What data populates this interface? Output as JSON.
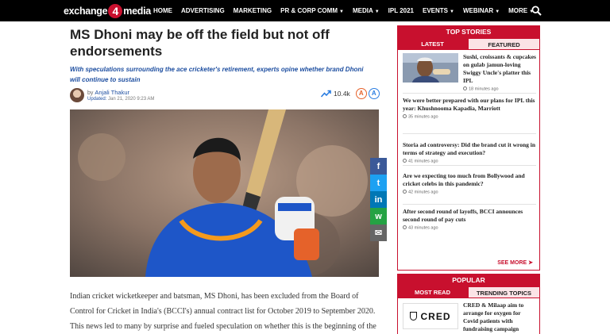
{
  "nav": {
    "logo_prefix": "exchange",
    "logo_number": "4",
    "logo_suffix": "media",
    "items": [
      {
        "label": "HOME",
        "dropdown": false
      },
      {
        "label": "ADVERTISING",
        "dropdown": false
      },
      {
        "label": "MARKETING",
        "dropdown": false
      },
      {
        "label": "PR & CORP COMM",
        "dropdown": true
      },
      {
        "label": "MEDIA",
        "dropdown": true
      },
      {
        "label": "IPL 2021",
        "dropdown": false
      },
      {
        "label": "EVENTS",
        "dropdown": true
      },
      {
        "label": "WEBINAR",
        "dropdown": true
      },
      {
        "label": "MORE",
        "dropdown": true
      }
    ],
    "search_icon": "search-icon"
  },
  "article": {
    "headline": "MS Dhoni may be off the field but not off endorsements",
    "subhead": "With speculations surrounding the ace cricketer's retirement, experts opine whether brand Dhoni will continue to sustain",
    "by_prefix": "by",
    "author": "Anjali Thakur",
    "updated_label": "Updated:",
    "updated_value": "Jan 21, 2020 9:23 AM",
    "views": "10.4k",
    "font_down": "A",
    "font_up": "A",
    "body": "Indian cricket wicketkeeper and batsman, MS Dhoni, has been excluded from the Board of Control for Cricket in India's (BCCI's) annual contract list for October 2019 to September 2020. This news led to many by surprise and fueled speculation on whether this is the beginning of the end of brand Dhoni or not."
  },
  "share": [
    {
      "icon": "facebook-icon",
      "glyph": "f",
      "color": "#3b5998"
    },
    {
      "icon": "twitter-icon",
      "glyph": "t",
      "color": "#1da1f2"
    },
    {
      "icon": "linkedin-icon",
      "glyph": "in",
      "color": "#0077b5"
    },
    {
      "icon": "whatsapp-icon",
      "glyph": "w",
      "color": "#25a244"
    },
    {
      "icon": "email-icon",
      "glyph": "✉",
      "color": "#666666"
    }
  ],
  "top_stories": {
    "heading": "TOP STORIES",
    "tab_latest": "LATEST",
    "tab_featured": "FEATURED",
    "stories": [
      {
        "title": "Sushi, croissants & cupcakes on gulab jamun-loving Swiggy Uncle's platter this IPL",
        "time": "18 minutes ago"
      },
      {
        "title": "We were better prepared with our plans for IPL this year: Khushnooma Kapadia, Marriott",
        "time": "35 minutes ago"
      },
      {
        "title": "Storia ad controversy: Did the brand cut it wrong in terms of strategy and execution?",
        "time": "41 minutes ago"
      },
      {
        "title": "Are we expecting too much from Bollywood and cricket celebs in this pandemic?",
        "time": "42 minutes ago"
      },
      {
        "title": "After second round of layoffs, BCCI announces second round of pay cuts",
        "time": "43 minutes ago"
      }
    ],
    "see_more": "SEE MORE"
  },
  "popular": {
    "heading": "POPULAR",
    "tab_most_read": "MOST READ",
    "tab_trending": "TRENDING TOPICS",
    "logo_text": "CRED",
    "title": "CRED & Milaap aim to arrange for oxygen for Covid patients with fundraising campaign"
  },
  "colors": {
    "brand_red": "#c8102e",
    "link_blue": "#1d4ea0"
  }
}
